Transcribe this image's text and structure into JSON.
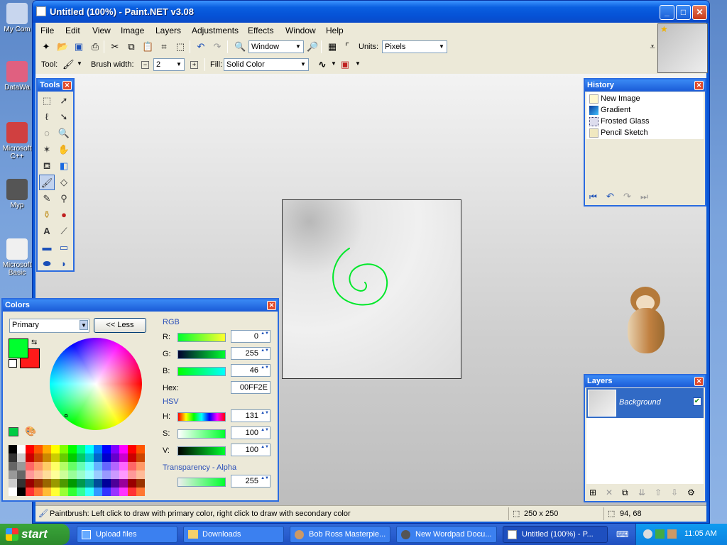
{
  "desktop": {
    "icons": [
      "My Com",
      "DataWa",
      "Microsoft C++",
      "Myp",
      "Microsoft Basic"
    ]
  },
  "window": {
    "title": "Untitled (100%) - Paint.NET v3.08",
    "controls": {
      "minimize": "_",
      "maximize": "□",
      "close": "✕"
    }
  },
  "menu": [
    "File",
    "Edit",
    "View",
    "Image",
    "Layers",
    "Adjustments",
    "Effects",
    "Window",
    "Help"
  ],
  "toolbar": {
    "zoom_value": "Window",
    "units_label": "Units:",
    "units_value": "Pixels",
    "tool_label": "Tool:",
    "brush_width_label": "Brush width:",
    "brush_width_value": "2",
    "fill_label": "Fill:",
    "fill_value": "Solid Color"
  },
  "tools_panel": {
    "title": "Tools"
  },
  "history_panel": {
    "title": "History",
    "items": [
      {
        "label": "New Image",
        "icon": "new-image-icon"
      },
      {
        "label": "Gradient",
        "icon": "gradient-icon"
      },
      {
        "label": "Frosted Glass",
        "icon": "frosted-glass-icon"
      },
      {
        "label": "Pencil Sketch",
        "icon": "pencil-sketch-icon"
      }
    ]
  },
  "layers_panel": {
    "title": "Layers",
    "layers": [
      {
        "name": "Background",
        "visible": true
      }
    ]
  },
  "colors_panel": {
    "title": "Colors",
    "target": "Primary",
    "less_button": "<< Less",
    "rgb_label": "RGB",
    "r_label": "R:",
    "r_value": "0",
    "g_label": "G:",
    "g_value": "255",
    "b_label": "B:",
    "b_value": "46",
    "hex_label": "Hex:",
    "hex_value": "00FF2E",
    "hsv_label": "HSV",
    "h_label": "H:",
    "h_value": "131",
    "s_label": "S:",
    "s_value": "100",
    "v_label": "V:",
    "v_value": "100",
    "alpha_label": "Transparency - Alpha",
    "alpha_value": "255",
    "primary_color": "#00ff2e",
    "secondary_color": "#ff1a1a"
  },
  "status": {
    "hint": "Paintbrush: Left click to draw with primary color, right click to draw with secondary color",
    "image_size": "250 x 250",
    "cursor_pos": "94, 68"
  },
  "taskbar": {
    "start": "start",
    "tasks": [
      {
        "label": "Upload files",
        "active": false
      },
      {
        "label": "Downloads",
        "active": false
      },
      {
        "label": "Bob Ross Masterpie...",
        "active": false
      },
      {
        "label": "New Wordpad Docu...",
        "active": false
      },
      {
        "label": "Untitled (100%) - P...",
        "active": true
      }
    ],
    "clock": "11:05 AM"
  },
  "stroke_color": "#00e82a"
}
